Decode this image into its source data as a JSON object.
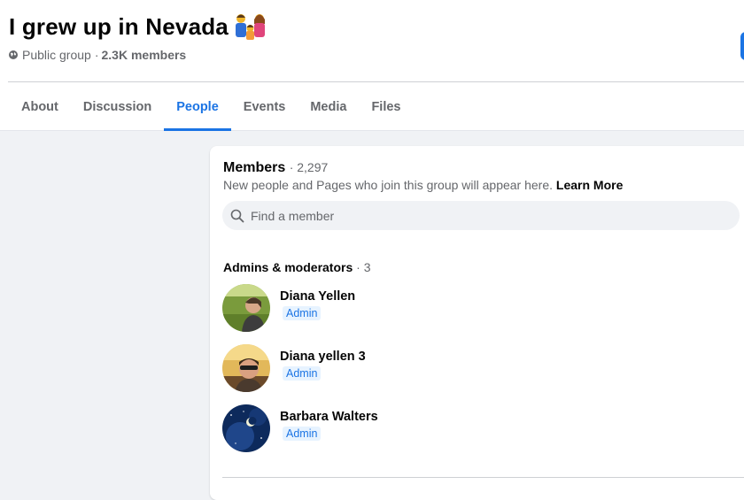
{
  "group": {
    "title": "I grew up in Nevada",
    "emoji_icon": "family-emoji",
    "privacy": "Public group",
    "separator": "·",
    "members_short": "2.3K members"
  },
  "tabs": [
    {
      "label": "About",
      "active": false
    },
    {
      "label": "Discussion",
      "active": false
    },
    {
      "label": "People",
      "active": true
    },
    {
      "label": "Events",
      "active": false
    },
    {
      "label": "Media",
      "active": false
    },
    {
      "label": "Files",
      "active": false
    }
  ],
  "members": {
    "label": "Members",
    "count": "· 2,297",
    "description": "New people and Pages who join this group will appear here.",
    "learn_more": "Learn More",
    "search_placeholder": "Find a member"
  },
  "admins": {
    "label": "Admins & moderators",
    "count": "· 3",
    "list": [
      {
        "name": "Diana Yellen",
        "role": "Admin"
      },
      {
        "name": "Diana yellen 3",
        "role": "Admin"
      },
      {
        "name": "Barbara Walters",
        "role": "Admin"
      }
    ]
  },
  "colors": {
    "accent": "#1b74e4",
    "page_bg": "#f0f2f5",
    "secondary_text": "#65676b"
  }
}
